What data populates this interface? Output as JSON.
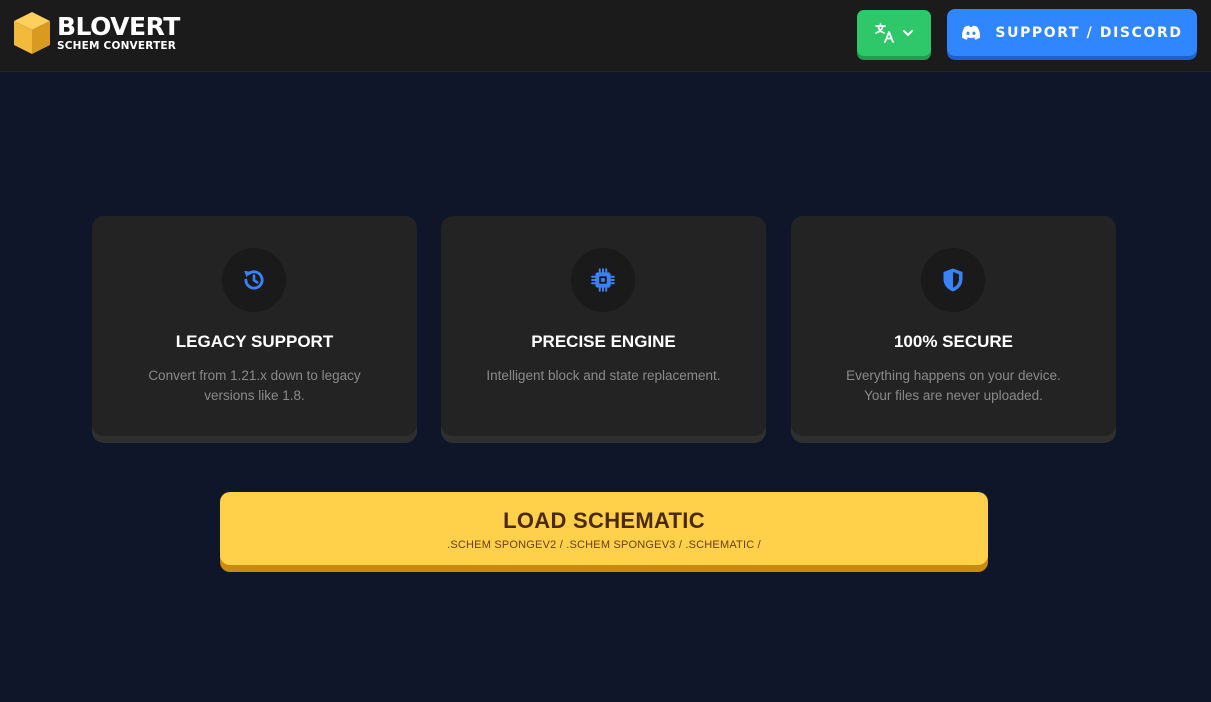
{
  "header": {
    "logo": {
      "title": "BLOVERT",
      "subtitle": "SCHEM CONVERTER",
      "icon": "cube-icon",
      "color": "#f2b93b"
    },
    "language_button": {
      "icon": "translate-icon",
      "chevron": "chevron-down-icon",
      "color": "#2ec76a"
    },
    "discord_button": {
      "label": "SUPPORT / DISCORD",
      "icon": "discord-icon",
      "color": "#2f86ff"
    }
  },
  "features": [
    {
      "icon": "history-icon",
      "title": "LEGACY SUPPORT",
      "description": "Convert from 1.21.x down to legacy versions like 1.8."
    },
    {
      "icon": "chip-icon",
      "title": "PRECISE ENGINE",
      "description": "Intelligent block and state replacement."
    },
    {
      "icon": "shield-icon",
      "title": "100% SECURE",
      "description": "Everything happens on your device. Your files are never uploaded."
    }
  ],
  "load_button": {
    "label": "LOAD SCHEMATIC",
    "formats": ".SCHEM SPONGEV2 / .SCHEM SPONGEV3 / .SCHEMATIC /",
    "color": "#ffd04a"
  },
  "accent_icon_color": "#3a82f7"
}
